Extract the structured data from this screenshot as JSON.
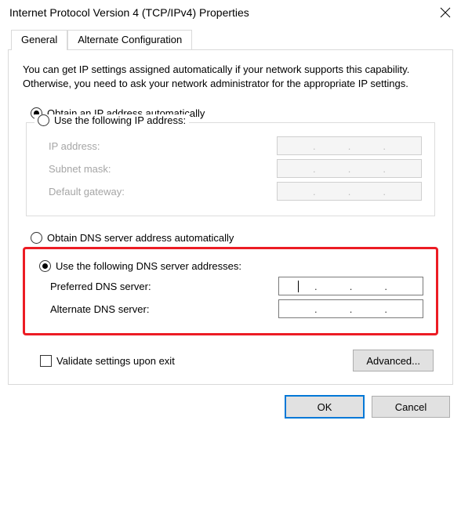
{
  "window": {
    "title": "Internet Protocol Version 4 (TCP/IPv4) Properties"
  },
  "tabs": {
    "general": "General",
    "alternate": "Alternate Configuration"
  },
  "intro": "You can get IP settings assigned automatically if your network supports this capability. Otherwise, you need to ask your network administrator for the appropriate IP settings.",
  "ip": {
    "auto": "Obtain an IP address automatically",
    "manual": "Use the following IP address:",
    "address_label": "IP address:",
    "subnet_label": "Subnet mask:",
    "gateway_label": "Default gateway:"
  },
  "dns": {
    "auto": "Obtain DNS server address automatically",
    "manual": "Use the following DNS server addresses:",
    "preferred_label": "Preferred DNS server:",
    "alternate_label": "Alternate DNS server:"
  },
  "validate": "Validate settings upon exit",
  "buttons": {
    "advanced": "Advanced...",
    "ok": "OK",
    "cancel": "Cancel"
  }
}
